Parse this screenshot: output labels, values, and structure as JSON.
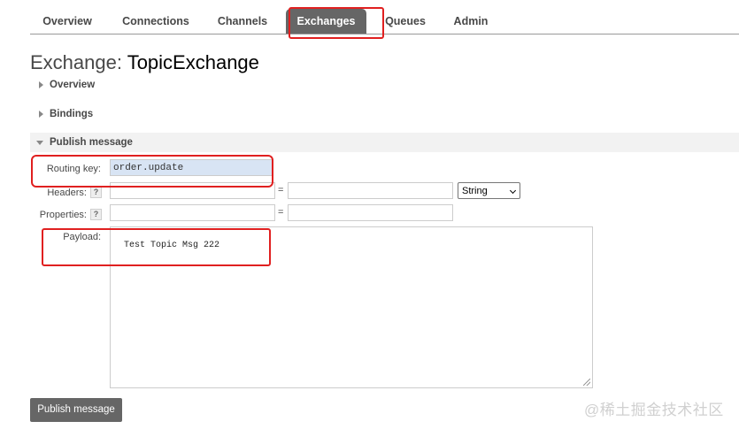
{
  "nav": {
    "tabs": [
      {
        "label": "Overview"
      },
      {
        "label": "Connections"
      },
      {
        "label": "Channels"
      },
      {
        "label": "Exchanges",
        "active": true
      },
      {
        "label": "Queues"
      },
      {
        "label": "Admin"
      }
    ]
  },
  "page": {
    "title_prefix": "Exchange:",
    "title_name": "TopicExchange"
  },
  "sections": {
    "overview": "Overview",
    "bindings": "Bindings",
    "publish": "Publish message"
  },
  "form": {
    "routing_key_label": "Routing key:",
    "routing_key_value": "order.update",
    "headers_label": "Headers:",
    "properties_label": "Properties:",
    "help_glyph": "?",
    "equals": "=",
    "header_type": "String",
    "payload_label": "Payload:",
    "payload_value": "Test Topic Msg 222"
  },
  "actions": {
    "publish_button": "Publish message"
  },
  "watermark": "@稀土掘金技术社区",
  "colors": {
    "active_tab_bg": "#666666",
    "highlight": "#e02020",
    "button_bg": "#666666"
  }
}
